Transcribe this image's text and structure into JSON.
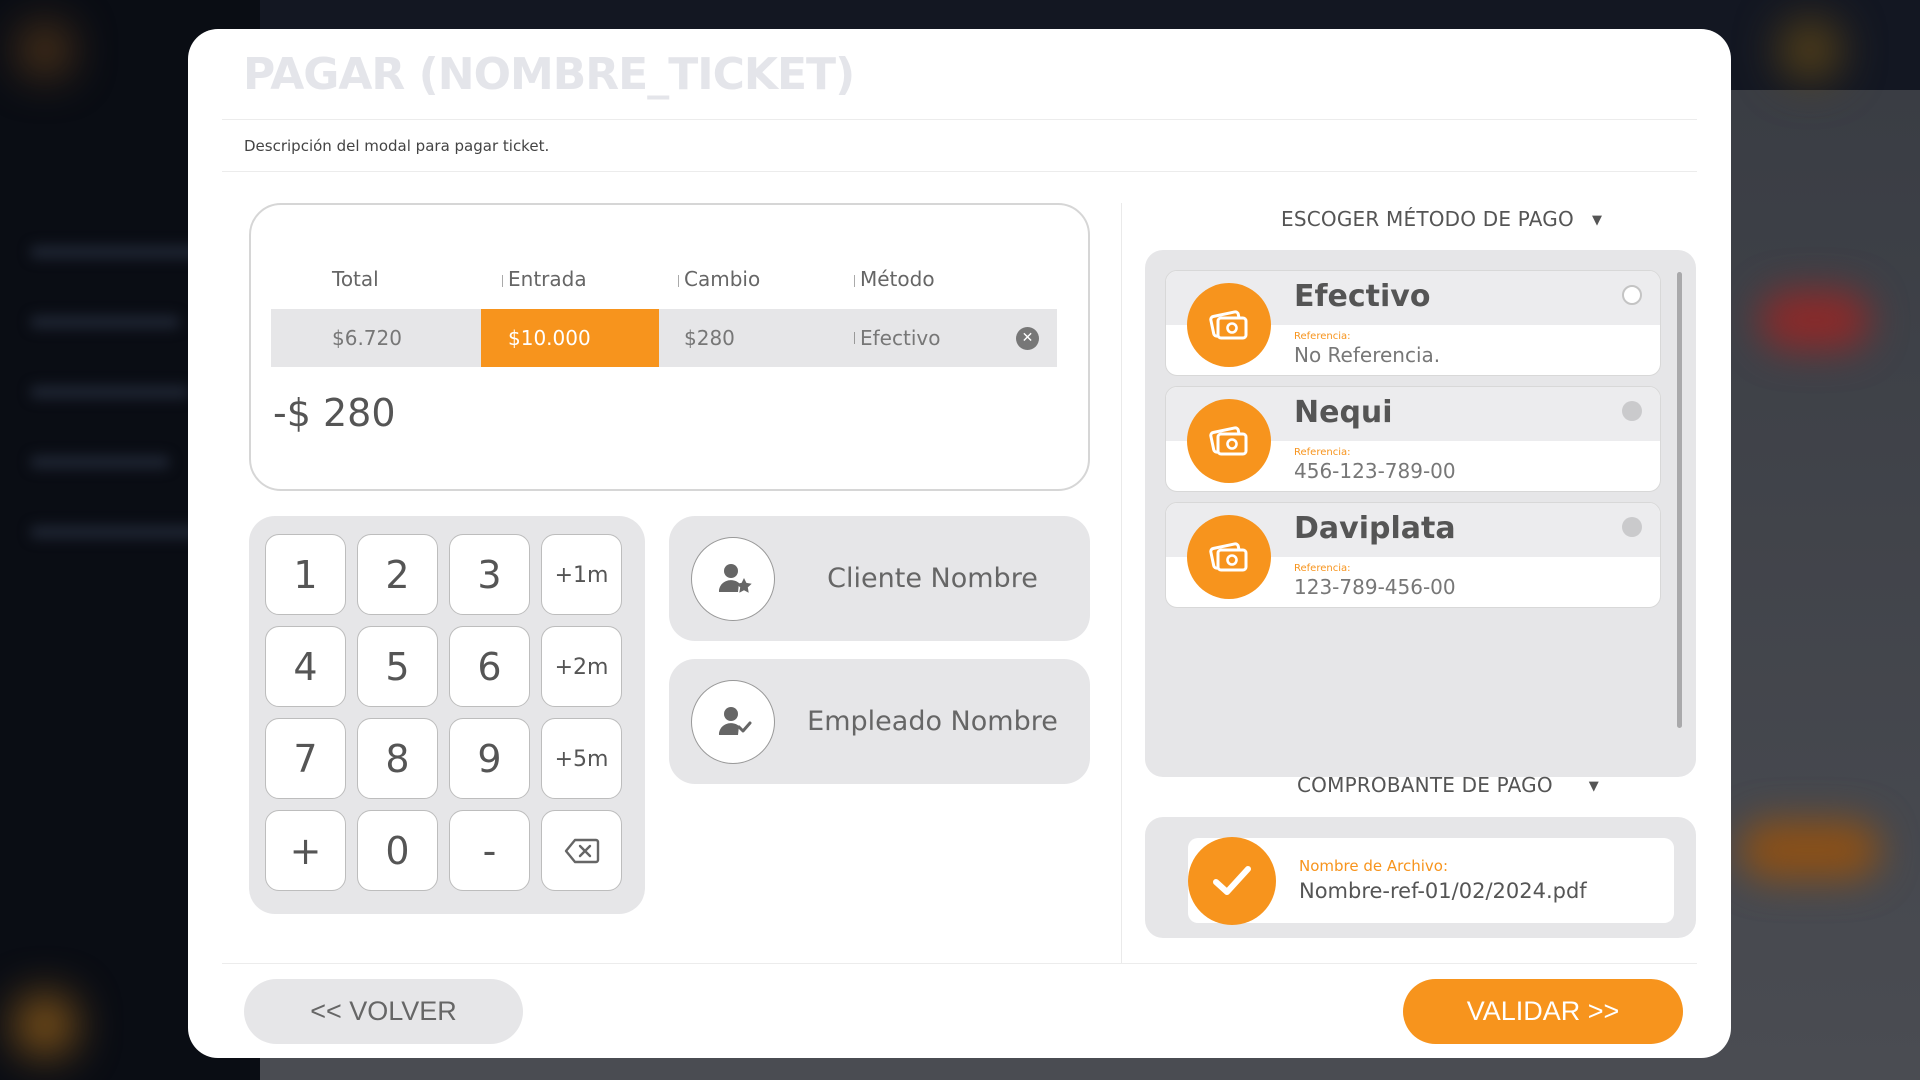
{
  "modal": {
    "title": "PAGAR (NOMBRE_TICKET)",
    "description": "Descripción del modal para pagar ticket."
  },
  "summary": {
    "headers": [
      "Total",
      "Entrada",
      "Cambio",
      "Método"
    ],
    "values": {
      "total": "$6.720",
      "entrada": "$10.000",
      "cambio": "$280",
      "metodo": "Efectivo"
    },
    "difference": "-$ 280"
  },
  "keypad": {
    "keys": [
      "1",
      "2",
      "3",
      "+1m",
      "4",
      "5",
      "6",
      "+2m",
      "7",
      "8",
      "9",
      "+5m",
      "+",
      "0",
      "-",
      "backspace-icon"
    ]
  },
  "people": {
    "client": "Cliente Nombre",
    "employee": "Empleado Nombre"
  },
  "payment_methods": {
    "title": "ESCOGER MÉTODO DE PAGO",
    "items": [
      {
        "name": "Efectivo",
        "ref_label": "Referencia:",
        "ref_value": "No Referencia.",
        "selected": false,
        "icon": "money-icon"
      },
      {
        "name": "Nequi",
        "ref_label": "Referencia:",
        "ref_value": "456-123-789-00",
        "selected": false,
        "icon": "money-icon"
      },
      {
        "name": "Daviplata",
        "ref_label": "Referencia:",
        "ref_value": "123-789-456-00",
        "selected": false,
        "icon": "money-icon"
      }
    ]
  },
  "proof": {
    "title": "COMPROBANTE DE PAGO",
    "file_label": "Nombre de Archivo:",
    "file_name": "Nombre-ref-01/02/2024.pdf"
  },
  "buttons": {
    "back": "<< VOLVER",
    "validate": "VALIDAR >>"
  },
  "colors": {
    "accent": "#f7941d",
    "panel": "#e6e6e8"
  }
}
